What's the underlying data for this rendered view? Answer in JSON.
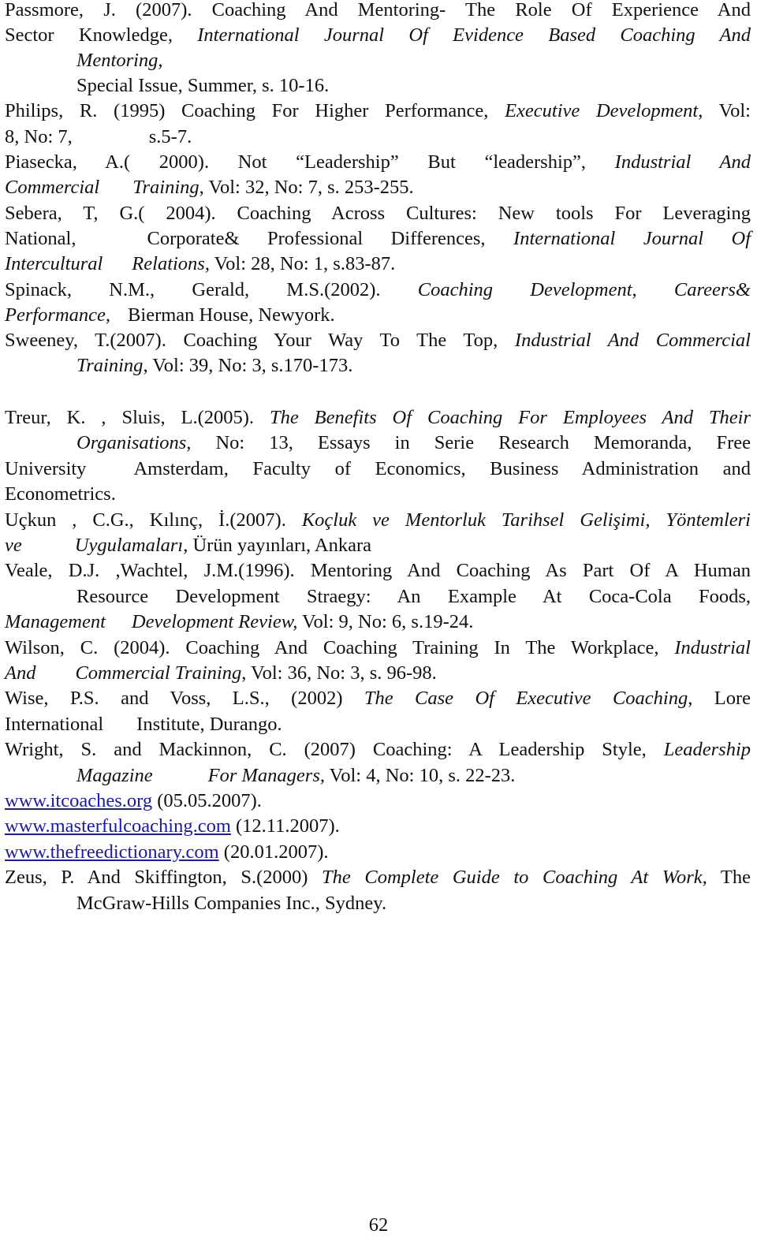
{
  "references": [
    {
      "lines": [
        {
          "parts": [
            {
              "t": "Passmore, J. (2007). Coaching And Mentoring- The Role Of Experience And"
            }
          ]
        },
        {
          "parts": [
            {
              "t": "Sector Knowledge, "
            },
            {
              "t": "International Journal Of  Evidence Based Coaching And",
              "i": true
            }
          ]
        },
        {
          "parts": [
            {
              "t": "Mentoring,",
              "i": true
            }
          ]
        },
        {
          "parts": [
            {
              "t": "Special Issue, Summer, s. 10-16."
            }
          ]
        }
      ]
    },
    {
      "lines": [
        {
          "parts": [
            {
              "t": "Philips, R. (1995) Coaching For Higher Performance, "
            },
            {
              "t": "Executive Development",
              "i": true
            },
            {
              "t": ", Vol:"
            }
          ]
        },
        {
          "parts": [
            {
              "t": "8, No: 7,"
            },
            {
              "t": "s.5-7."
            }
          ]
        }
      ]
    },
    {
      "lines": [
        {
          "parts": [
            {
              "t": "Piasecka, A.( 2000). Not “Leadership” But “leadership”, "
            },
            {
              "t": "Industrial And",
              "i": true
            }
          ]
        },
        {
          "parts": [
            {
              "t": "Commercial",
              "i": true
            },
            {
              "t": "Training",
              "i": true
            },
            {
              "t": ", Vol: 32, No: 7, s. 253-255."
            }
          ]
        }
      ]
    },
    {
      "lines": [
        {
          "parts": [
            {
              "t": "Sebera, T, G.( 2004). Coaching Across Cultures: New tools For Leveraging"
            }
          ]
        },
        {
          "parts": [
            {
              "t": "National,"
            },
            {
              "t": "Corporate& Professional Differences, "
            },
            {
              "t": "International Journal Of",
              "i": true
            }
          ]
        },
        {
          "parts": [
            {
              "t": "Intercultural",
              "i": true
            },
            {
              "t": "Relations,",
              "i": true
            },
            {
              "t": " Vol: 28, No: 1, s.83-87."
            }
          ]
        }
      ]
    },
    {
      "lines": [
        {
          "parts": [
            {
              "t": "Spinack, N.M., Gerald, M.S.(2002). "
            },
            {
              "t": "Coaching Development, Careers&",
              "i": true
            }
          ]
        },
        {
          "parts": [
            {
              "t": "Performance,",
              "i": true
            },
            {
              "t": "Bierman House, Newyork."
            }
          ]
        }
      ]
    },
    {
      "lines": [
        {
          "parts": [
            {
              "t": "Sweeney, T.(2007). Coaching Your Way To The Top, "
            },
            {
              "t": "Industrial And Commercial",
              "i": true
            }
          ]
        },
        {
          "parts": [
            {
              "t": "Training",
              "i": true
            },
            {
              "t": ", Vol: 39, No: 3, s.170-173."
            }
          ]
        }
      ]
    },
    {
      "lines": [
        {
          "parts": [
            {
              "t": "Treur, K. , Sluis, L.(2005). "
            },
            {
              "t": "The Benefits Of Coaching For Employees And Their",
              "i": true
            }
          ]
        },
        {
          "parts": [
            {
              "t": "Organisations,",
              "i": true
            },
            {
              "t": " No: 13, Essays in Serie Research Memoranda, Free"
            }
          ]
        },
        {
          "parts": [
            {
              "t": "University"
            },
            {
              "t": "Amsterdam, Faculty of Economics, Business Administration and"
            }
          ]
        },
        {
          "parts": [
            {
              "t": "Econometrics."
            }
          ]
        }
      ]
    },
    {
      "lines": [
        {
          "parts": [
            {
              "t": "Uçkun , C.G., Kılınç, İ.(2007). "
            },
            {
              "t": "Koçluk ve Mentorluk Tarihsel Gelişimi, Yöntemleri",
              "i": true
            }
          ]
        },
        {
          "parts": [
            {
              "t": "ve",
              "i": true
            },
            {
              "t": "Uygulamaları",
              "i": true
            },
            {
              "t": ", Ürün yayınları, Ankara"
            }
          ]
        }
      ]
    },
    {
      "lines": [
        {
          "parts": [
            {
              "t": "Veale, D.J. ,Wachtel, J.M.(1996). Mentoring And Coaching As Part Of A Human"
            }
          ]
        },
        {
          "parts": [
            {
              "t": "Resource Development Straegy: An Example At Coca-Cola Foods,"
            }
          ]
        },
        {
          "parts": [
            {
              "t": "Management",
              "i": true
            },
            {
              "t": "Development Review,",
              "i": true
            },
            {
              "t": " Vol: 9, No: 6, s.19-24."
            }
          ]
        }
      ]
    },
    {
      "lines": [
        {
          "parts": [
            {
              "t": "Wilson, C. (2004). Coaching And Coaching Training In The Workplace, "
            },
            {
              "t": "Industrial",
              "i": true
            }
          ]
        },
        {
          "parts": [
            {
              "t": "And",
              "i": true
            },
            {
              "t": "Commercial Training",
              "i": true
            },
            {
              "t": ", Vol: 36, No: 3, s. 96-98."
            }
          ]
        }
      ]
    },
    {
      "lines": [
        {
          "parts": [
            {
              "t": "Wise, P.S. and Voss, L.S., (2002) "
            },
            {
              "t": "The Case Of Executive Coaching",
              "i": true
            },
            {
              "t": ", Lore"
            }
          ]
        },
        {
          "parts": [
            {
              "t": "International"
            },
            {
              "t": "Institute, Durango."
            }
          ]
        }
      ]
    },
    {
      "lines": [
        {
          "parts": [
            {
              "t": "Wright, S. and Mackinnon, C. (2007) Coaching: A Leadership Style, "
            },
            {
              "t": "Leadership",
              "i": true
            }
          ]
        },
        {
          "parts": [
            {
              "t": "Magazine",
              "i": true
            },
            {
              "t": "For Managers,",
              "i": true
            },
            {
              "t": " Vol: 4, No: 10, s. 22-23."
            }
          ]
        }
      ]
    }
  ],
  "web_links": [
    {
      "url": "www.itcoaches.org",
      "date": " (05.05.2007)."
    },
    {
      "url": "www.masterfulcoaching.com",
      "date": " (12.11.2007)."
    },
    {
      "url": "www.thefreedictionary.com",
      "date": " (20.01.2007)."
    }
  ],
  "zeus": {
    "line1": {
      "author": "Zeus, P. And Skiffington, S.(2000) ",
      "title": "The Complete Guide to Coaching At Work,",
      "after": " The"
    },
    "line2": "McGraw-Hills Companies Inc., Sydney."
  },
  "page_number": "62",
  "colors": {
    "link": "#1a1aa6",
    "text": "#111111"
  }
}
